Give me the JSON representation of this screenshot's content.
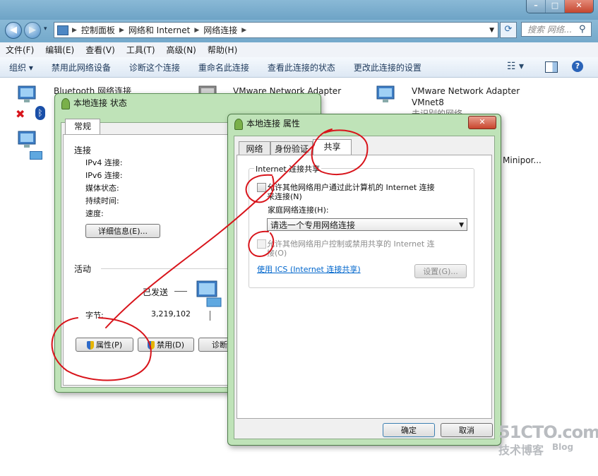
{
  "explorer": {
    "breadcrumb": [
      "控制面板",
      "网络和 Internet",
      "网络连接"
    ],
    "search_placeholder": "搜索 网络...",
    "menu": [
      "文件(F)",
      "编辑(E)",
      "查看(V)",
      "工具(T)",
      "高级(N)",
      "帮助(H)"
    ],
    "toolbar": [
      "组织 ▾",
      "禁用此网络设备",
      "诊断这个连接",
      "重命名此连接",
      "查看此连接的状态",
      "更改此连接的设置"
    ],
    "items": [
      {
        "name": "Bluetooth 网络连接"
      },
      {
        "name": "VMware Network Adapter"
      },
      {
        "name": "VMware Network Adapter",
        "sub": "VMnet8",
        "sub2": "未识别的网络"
      },
      {
        "partial": "Minipor..."
      }
    ]
  },
  "status_dialog": {
    "title": "本地连接 状态",
    "tab": "常规",
    "connection_header": "连接",
    "rows": [
      "IPv4 连接:",
      "IPv6 连接:",
      "媒体状态:",
      "持续时间:",
      "速度:"
    ],
    "details_btn": "详细信息(E)...",
    "activity_header": "活动",
    "sent_label": "已发送",
    "bytes_label": "字节:",
    "bytes_sent": "3,219,102",
    "properties_btn": "属性(P)",
    "disable_btn": "禁用(D)",
    "diagnose_btn": "诊断"
  },
  "props_dialog": {
    "title": "本地连接 属性",
    "tabs": [
      "网络",
      "身份验证",
      "共享"
    ],
    "group_title": "Internet 连接共享",
    "allow_share_l1": "允许其他网络用户通过此计算机的 Internet 连接",
    "allow_share_l2": "来连接(N)",
    "home_net_label": "家庭网络连接(H):",
    "home_net_value": "请选一个专用网络连接",
    "allow_control_l1": "允许其他网络用户控制或禁用共享的 Internet 连",
    "allow_control_l2": "接(O)",
    "ics_link": "使用 ICS (Internet 连接共享)",
    "settings_btn": "设置(G)...",
    "ok_btn": "确定",
    "cancel_btn": "取消"
  },
  "watermark": {
    "site": "51CTO.com",
    "sub1": "技术博客",
    "sub2": "Blog"
  },
  "colors": {
    "annotation": "#d8141b",
    "dialog_frame": "#bfe3b8",
    "link": "#0066cc"
  }
}
